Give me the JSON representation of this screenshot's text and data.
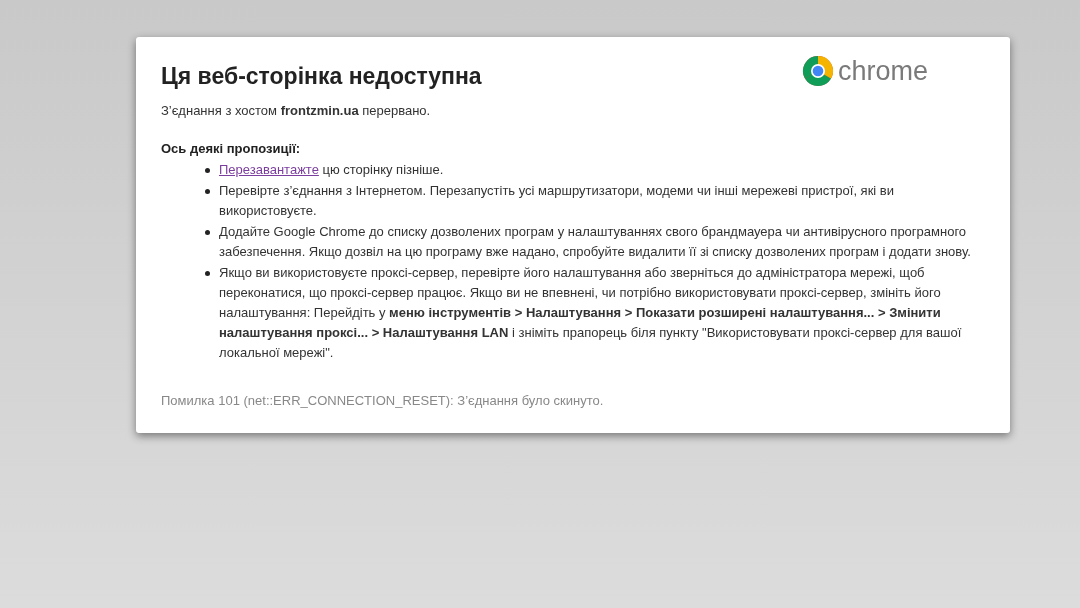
{
  "page": {
    "title": "Ця веб-сторінка недоступна",
    "logo_text": "chrome",
    "message": "З’єднання з хостом **frontzmin.ua** перервано.",
    "suggestions_heading": "Ось деякі пропозиції:",
    "suggestions": [
      {
        "link": "Перезавантажте",
        "text": " цю сторінку пізніше."
      },
      {
        "text": "Перевірте з’єднання з Інтернетом. Перезапустіть усі маршрутизатори, модеми чи інші мережеві пристрої, які ви використовуєте."
      },
      {
        "text": "Додайте Google Chrome до списку дозволених програм у налаштуваннях свого брандмауера чи антивірусного програмного забезпечення. Якщо дозвіл на цю програму вже надано, спробуйте видалити її зі списку дозволених програм і додати знову."
      },
      {
        "text": "Якщо ви використовуєте проксі-сервер, перевірте його налаштування або зверніться до адміністратора мережі, щоб переконатися, що проксі-сервер працює. Якщо ви не впевнені, чи потрібно використовувати проксі-сервер, змініть його налаштування: Перейдіть у **меню інструментів > Налаштування > Показати розширені налаштування... > Змінити налаштування проксі... > Налаштування LAN** і зніміть прапорець біля пункту \"Використовувати проксі-сервер для вашої локальної мережі\"."
      }
    ],
    "error_detail": "Помилка 101 (net::ERR_CONNECTION_RESET): З’єднання було скинуто."
  }
}
